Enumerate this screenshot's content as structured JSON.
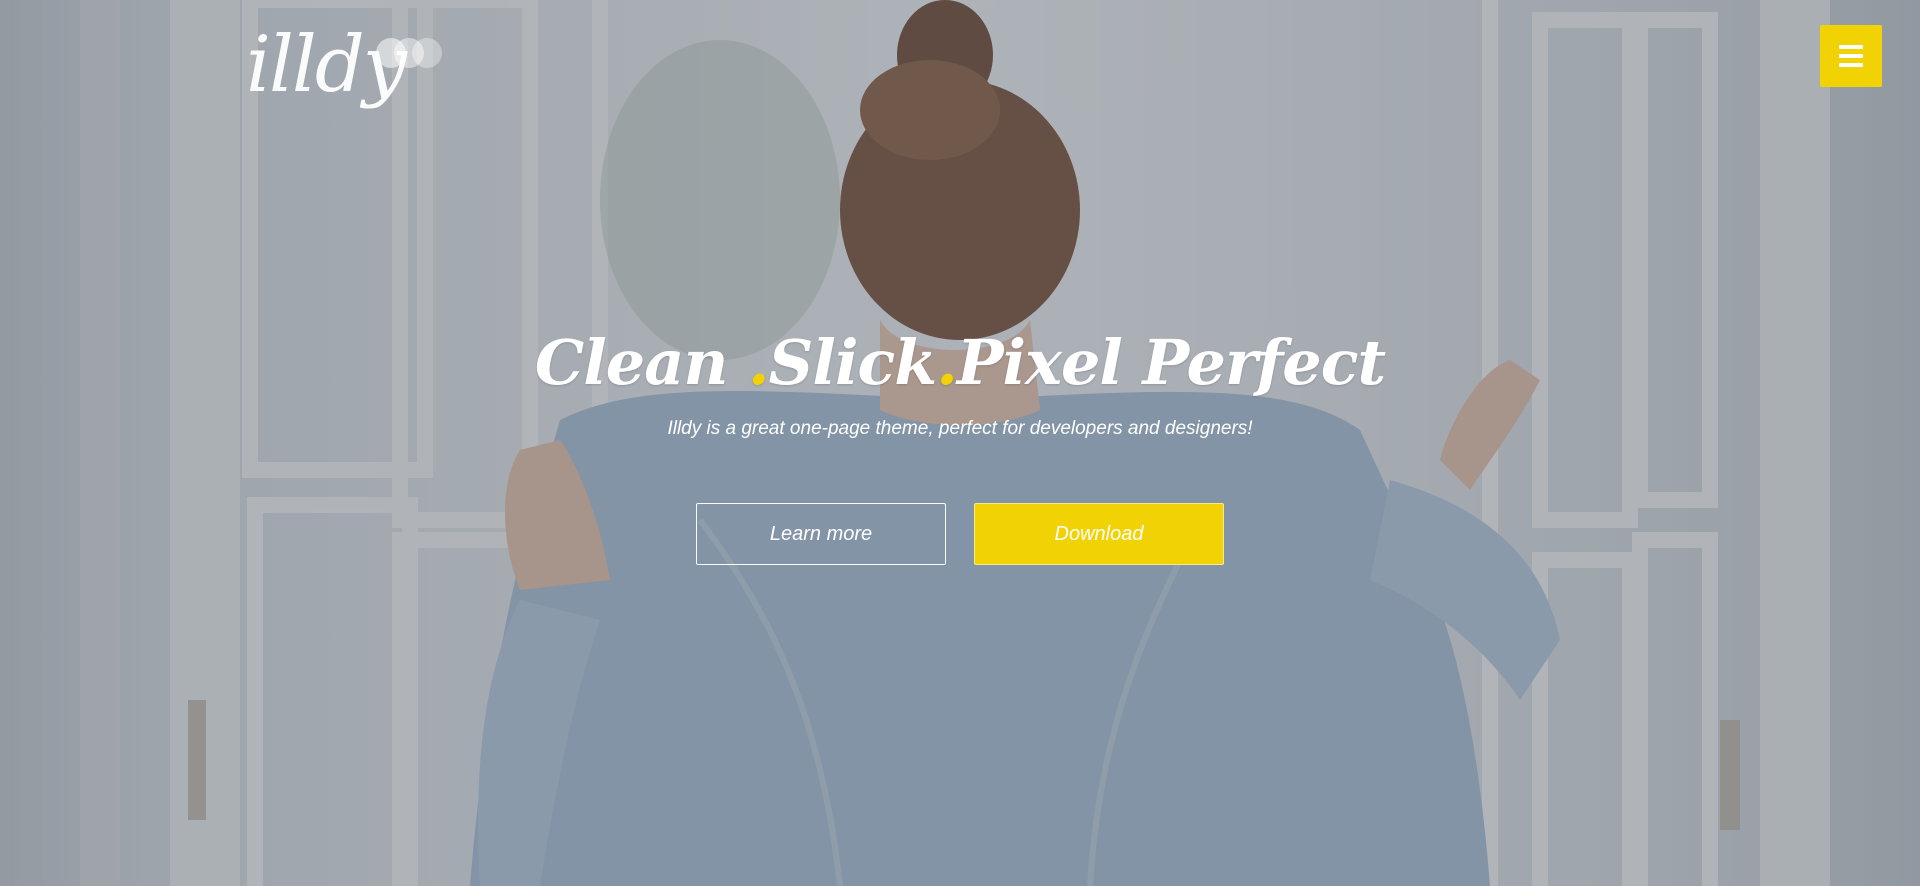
{
  "logo": {
    "text": "illdy"
  },
  "menu": {
    "icon": "hamburger-menu-icon"
  },
  "hero": {
    "headline": {
      "part1": "Clean ",
      "sep1": ".",
      "part2": "Slick",
      "sep2": ".",
      "part3": "Pixel Perfect"
    },
    "subtitle": "Illdy is a great one-page theme, perfect for developers and designers!",
    "buttons": {
      "learn_more": "Learn more",
      "download": "Download"
    }
  },
  "colors": {
    "accent": "#f1d204",
    "text": "#ffffff"
  }
}
